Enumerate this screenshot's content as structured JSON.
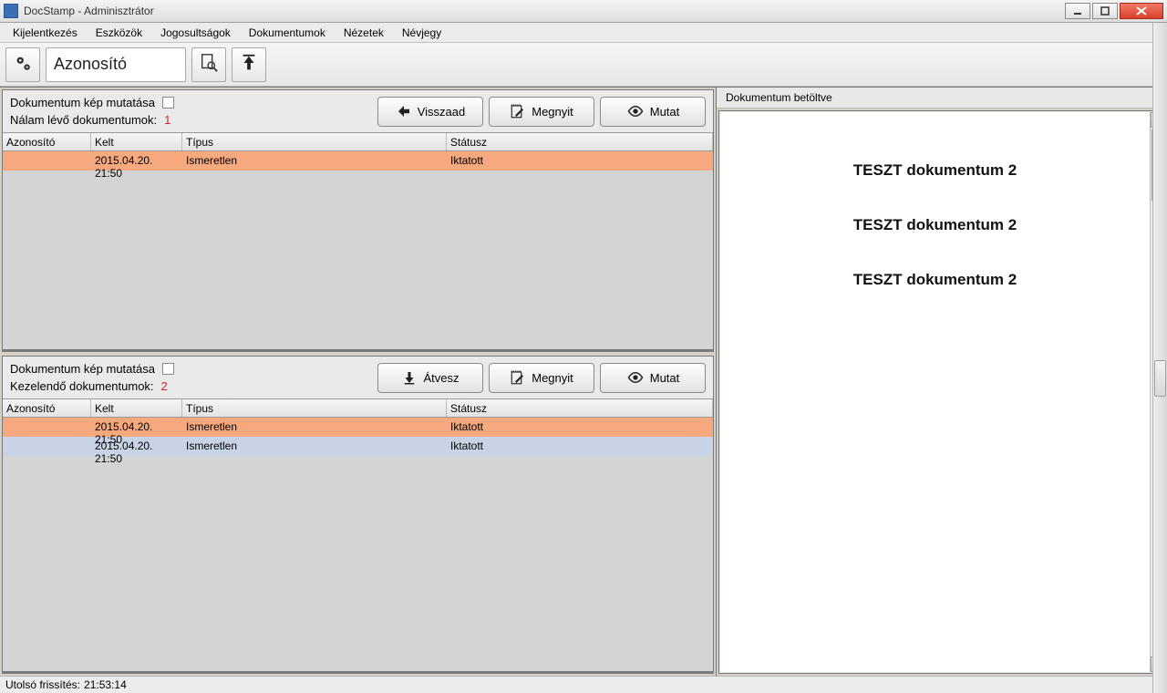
{
  "window": {
    "title": "DocStamp - Adminisztrátor"
  },
  "menu": {
    "items": [
      "Kijelentkezés",
      "Eszközök",
      "Jogosultságok",
      "Dokumentumok",
      "Nézetek",
      "Névjegy"
    ]
  },
  "toolbar": {
    "search_value": "Azonosító"
  },
  "panel_top": {
    "show_image_label": "Dokumentum kép mutatása",
    "count_label": "Nálam lévő dokumentumok:",
    "count_value": "1",
    "btn_return": "Visszaad",
    "btn_open": "Megnyit",
    "btn_show": "Mutat",
    "columns": {
      "id": "Azonosító",
      "kelt": "Kelt",
      "tipus": "Típus",
      "status": "Státusz"
    },
    "rows": [
      {
        "id": "",
        "kelt": "2015.04.20. 21:50",
        "tipus": "Ismeretlen",
        "status": "Iktatott",
        "selected": true
      }
    ]
  },
  "panel_bottom": {
    "show_image_label": "Dokumentum kép mutatása",
    "count_label": "Kezelendő dokumentumok:",
    "count_value": "2",
    "btn_take": "Átvesz",
    "btn_open": "Megnyit",
    "btn_show": "Mutat",
    "columns": {
      "id": "Azonosító",
      "kelt": "Kelt",
      "tipus": "Típus",
      "status": "Státusz"
    },
    "rows": [
      {
        "id": "",
        "kelt": "2015.04.20. 21:50",
        "tipus": "Ismeretlen",
        "status": "Iktatott",
        "selected": true
      },
      {
        "id": "",
        "kelt": "2015.04.20. 21:50",
        "tipus": "Ismeretlen",
        "status": "Iktatott",
        "alt": true
      }
    ]
  },
  "preview": {
    "header": "Dokumentum betöltve",
    "lines": [
      "TESZT dokumentum 2",
      "TESZT dokumentum 2",
      "TESZT dokumentum 2"
    ]
  },
  "statusbar": {
    "last_refresh_label": "Utolsó frissítés:",
    "last_refresh_value": "21:53:14"
  }
}
